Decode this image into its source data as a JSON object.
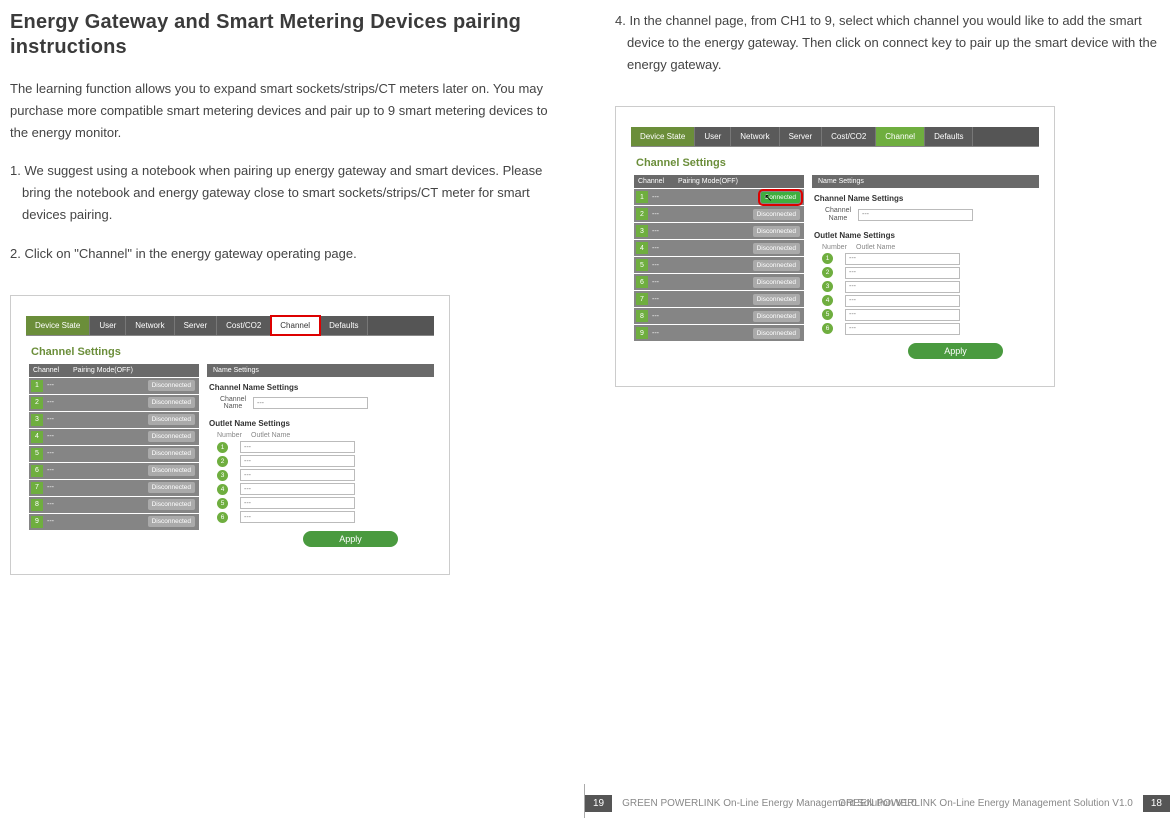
{
  "left": {
    "title": "Energy Gateway and Smart Metering Devices pairing instructions",
    "intro": "The learning function allows you to expand smart sockets/strips/CT meters later on. You may purchase more compatible smart metering devices and pair up to 9 smart metering devices to the energy monitor.",
    "step1": "1. We suggest using a notebook when pairing up energy gateway and smart devices. Please bring the notebook and energy gateway close to smart sockets/strips/CT meter for smart devices pairing.",
    "step2": "2. Click on \"Channel\" in the energy gateway operating page."
  },
  "right": {
    "step4": "4. In the channel page, from CH1 to 9, select which channel you would like to add the smart device to the energy gateway. Then click on connect key to pair up the smart device with the energy gateway."
  },
  "nav": {
    "device_state": "Device State",
    "user": "User",
    "network": "Network",
    "server": "Server",
    "cost_co2": "Cost/CO2",
    "channel": "Channel",
    "defaults": "Defaults"
  },
  "panel": {
    "title": "Channel Settings",
    "head_channel": "Channel",
    "head_pairing": "Pairing Mode(OFF)",
    "head_name": "Name Settings",
    "channel_name_settings": "Channel Name Settings",
    "channel_name_label": "Channel Name",
    "outlet_name_settings": "Outlet Name Settings",
    "outlet_number": "Number",
    "outlet_name": "Outlet Name",
    "apply": "Apply",
    "disconnected": "Disconnected",
    "connected": "Connected",
    "dash": "---",
    "field_dash": "---",
    "channels": [
      "1",
      "2",
      "3",
      "4",
      "5",
      "6",
      "7",
      "8",
      "9"
    ],
    "outlets": [
      "1",
      "2",
      "3",
      "4",
      "5",
      "6"
    ]
  },
  "footer": {
    "text": "GREEN POWERLINK On-Line Energy Management Solution   V1.0",
    "page_left": "18",
    "page_right": "19"
  }
}
